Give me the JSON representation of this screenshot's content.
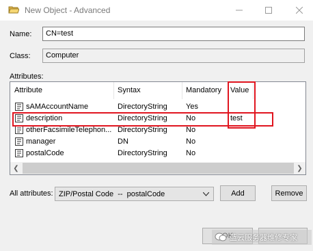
{
  "window": {
    "title": "New Object - Advanced"
  },
  "name": {
    "label": "Name:",
    "value": "CN=test"
  },
  "class": {
    "label": "Class:",
    "value": "Computer"
  },
  "attributes": {
    "label": "Attributes:",
    "columns": [
      "Attribute",
      "Syntax",
      "Mandatory",
      "Value"
    ],
    "rows": [
      {
        "attribute": "sAMAccountName",
        "syntax": "DirectoryString",
        "mandatory": "Yes",
        "value": ""
      },
      {
        "attribute": "description",
        "syntax": "DirectoryString",
        "mandatory": "No",
        "value": "test"
      },
      {
        "attribute": "otherFacsimileTelephon...",
        "syntax": "DirectoryString",
        "mandatory": "No",
        "value": ""
      },
      {
        "attribute": "manager",
        "syntax": "DN",
        "mandatory": "No",
        "value": ""
      },
      {
        "attribute": "postalCode",
        "syntax": "DirectoryString",
        "mandatory": "No",
        "value": ""
      }
    ]
  },
  "all_attributes": {
    "label": "All attributes:",
    "selected": "ZIP/Postal Code  --  postalCode"
  },
  "buttons": {
    "add": "Add",
    "remove": "Remove",
    "ok": "OK"
  },
  "watermark": {
    "text": "蓝云服务器维修专家"
  },
  "colors": {
    "highlight": "#e0141e",
    "window_bg": "#f0f0f0"
  }
}
